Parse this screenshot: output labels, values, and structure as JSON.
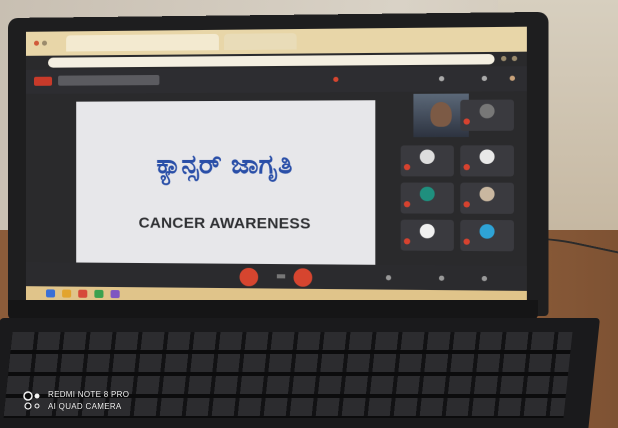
{
  "photo": {
    "slide": {
      "title_kannada": "ಕ್ಯಾನ್ಸರ್ ಜಾಗೃತಿ",
      "title_english": "CANCER AWARENESS"
    },
    "watermark": {
      "line1": "REDMI NOTE 8 PRO",
      "line2": "AI QUAD CAMERA",
      "icon": "camera-lens-dots-icon"
    },
    "colors": {
      "slide_text": "#2a4fa8",
      "end_call": "#d6452f",
      "browser_bar": "#e8d6a8"
    }
  }
}
